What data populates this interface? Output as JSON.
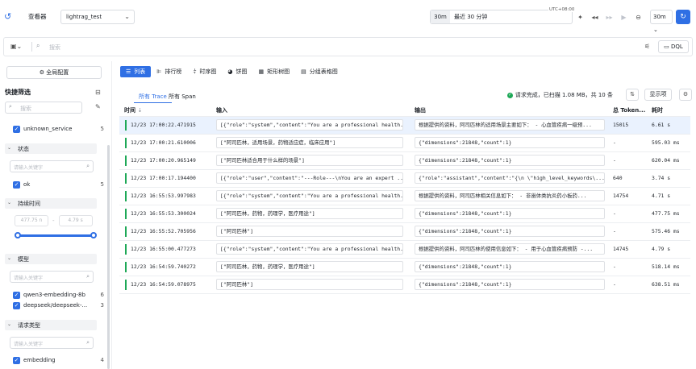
{
  "topbar": {
    "viewer_label": "查看器",
    "project": "lightrag_test",
    "time_segment": "30m",
    "time_label": "最近 30 分钟",
    "utc": "UTC+08:00",
    "refresh_label": "30m"
  },
  "search": {
    "placeholder": "搜索",
    "dql_label": "DQL"
  },
  "left": {
    "config_label": "全局配置",
    "quick_filter_title": "快捷筛选",
    "search_placeholder": "搜索",
    "service_item": {
      "label": "unknown_service",
      "count": "5"
    },
    "status_section": "状态",
    "status_kw_placeholder": "请输入关键字",
    "status_item": {
      "label": "ok",
      "count": "5"
    },
    "duration_section": "持续时间",
    "duration_min": "477.75 n",
    "duration_sep": "-",
    "duration_max": "4.79 s",
    "model_section": "模型",
    "model_kw_placeholder": "请输入关键字",
    "model_items": [
      {
        "label": "qwen3-embedding-8b",
        "count": "6"
      },
      {
        "label": "deepseek/deepseek-...",
        "count": "3"
      }
    ],
    "req_section": "请求类型",
    "req_kw_placeholder": "请输入关键字",
    "req_item": {
      "label": "embedding",
      "count": "4"
    }
  },
  "view_tabs": [
    {
      "label": "列表",
      "icon": "list-icon"
    },
    {
      "label": "排行榜",
      "icon": "ranking-icon"
    },
    {
      "label": "时序图",
      "icon": "timeseries-icon"
    },
    {
      "label": "饼图",
      "icon": "pie-icon"
    },
    {
      "label": "矩形树图",
      "icon": "treemap-icon"
    },
    {
      "label": "分组表格图",
      "icon": "grouped-table-icon"
    }
  ],
  "sub_tabs": [
    "所有 Trace",
    "所有 Span"
  ],
  "status_text": "请求完成，已扫描 1.08 MB，共 10 条",
  "show_label": "显示项",
  "table": {
    "headers": {
      "time": "时间",
      "input": "输入",
      "output": "输出",
      "tokens": "总 Token...",
      "duration": "耗时"
    },
    "rows": [
      {
        "time": "12/23 17:00:22.471915",
        "input": "[{\"role\":\"system\",\"content\":\"You are a professional health...",
        "output": "根据提供的资料，阿司匹林的适用场景主要如下：  - 心血管疾病一级预...",
        "tokens": "15015",
        "duration": "6.61 s"
      },
      {
        "time": "12/23 17:00:21.610006",
        "input": "[\"阿司匹林，适用场景，药物适应症，临床应用\"]",
        "output": "{\"dimensions\":21848,\"count\":1}",
        "tokens": "-",
        "duration": "595.03 ms"
      },
      {
        "time": "12/23 17:00:20.965149",
        "input": "[\"阿司匹林适合用于什么样的场景\"]",
        "output": "{\"dimensions\":21848,\"count\":1}",
        "tokens": "-",
        "duration": "620.04 ms"
      },
      {
        "time": "12/23 17:00:17.194400",
        "input": "[{\"role\":\"user\",\"content\":\"---Role---\\nYou are an expert ...",
        "output": "{\"role\":\"assistant\",\"content\":\"{\\n \\\"high_level_keywords\\...",
        "tokens": "640",
        "duration": "3.74 s"
      },
      {
        "time": "12/23 16:55:53.997983",
        "input": "[{\"role\":\"system\",\"content\":\"You are a professional health...",
        "output": "根据提供的资料，阿司匹林相关信息如下：  - 非甾体类抗炎药小板药...",
        "tokens": "14754",
        "duration": "4.71 s"
      },
      {
        "time": "12/23 16:55:53.300024",
        "input": "[\"阿司匹林，药物，药理学，医疗用途\"]",
        "output": "{\"dimensions\":21848,\"count\":1}",
        "tokens": "-",
        "duration": "477.75 ms"
      },
      {
        "time": "12/23 16:55:52.705956",
        "input": "[\"阿司匹林\"]",
        "output": "{\"dimensions\":21848,\"count\":1}",
        "tokens": "-",
        "duration": "575.46 ms"
      },
      {
        "time": "12/23 16:55:00.477273",
        "input": "[{\"role\":\"system\",\"content\":\"You are a professional health...",
        "output": "根据提供的资料，阿司匹林的使用信息如下：  - 用于心血管疾病预防 -...",
        "tokens": "14745",
        "duration": "4.79 s"
      },
      {
        "time": "12/23 16:54:59.740272",
        "input": "[\"阿司匹林，药物，药理学，医疗用途\"]",
        "output": "{\"dimensions\":21848,\"count\":1}",
        "tokens": "-",
        "duration": "518.14 ms"
      },
      {
        "time": "12/23 16:54:59.078975",
        "input": "[\"阿司匹林\"]",
        "output": "{\"dimensions\":21848,\"count\":1}",
        "tokens": "-",
        "duration": "638.51 ms"
      }
    ]
  },
  "colors": {
    "accent": "#2f6fe4",
    "success": "#1ea857",
    "highlight_row": "#eaf2fe"
  }
}
